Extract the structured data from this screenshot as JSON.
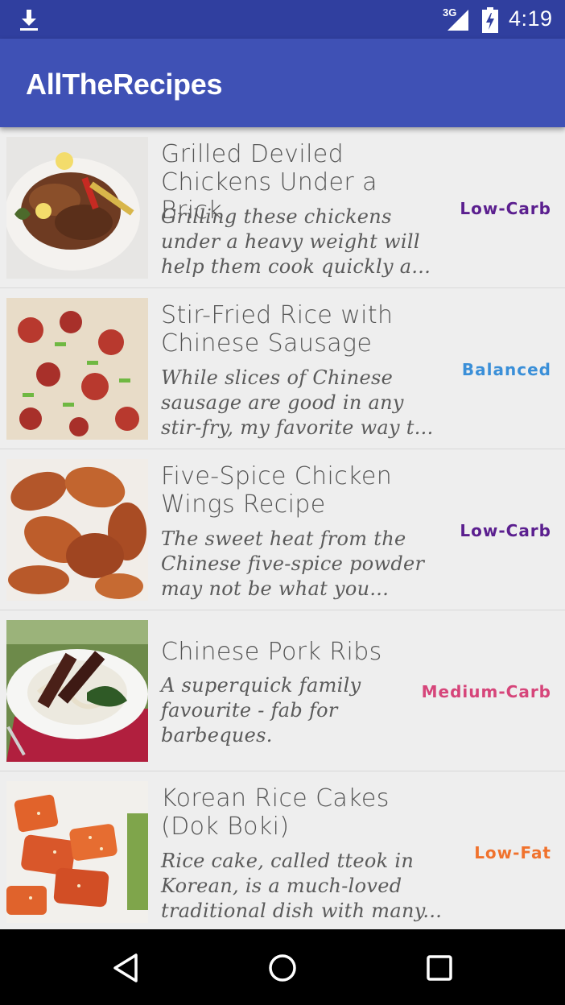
{
  "status_bar": {
    "time": "4:19",
    "network": "3G",
    "icons": [
      "download-icon",
      "signal-icon",
      "battery-icon"
    ]
  },
  "app_bar": {
    "title": "AllTheRecipes"
  },
  "colors": {
    "status_bar": "#303f9f",
    "app_bar": "#3f51b5",
    "low_carb": "#5b1f8f",
    "balanced": "#3a8fd8",
    "medium_carb": "#d6457a",
    "low_fat": "#f0722d"
  },
  "recipes": [
    {
      "title": "Grilled Deviled Chickens Under a Brick",
      "description": "Grilling these chickens under a heavy weight will help them cook quickly a...",
      "tag": "Low-Carb"
    },
    {
      "title": "Stir-Fried Rice with Chinese Sausage",
      "description": "While slices of Chinese sausage are good in any stir-fry, my favorite way t...",
      "tag": "Balanced"
    },
    {
      "title": "Five-Spice Chicken Wings Recipe",
      "description": "The sweet heat from the Chinese five-spice powder may not be what you...",
      "tag": "Low-Carb"
    },
    {
      "title": "Chinese Pork Ribs",
      "description": "A superquick family favourite - fab for barbeques.",
      "tag": "Medium-Carb"
    },
    {
      "title": "Korean Rice Cakes (Dok Boki)",
      "description": "Rice cake, called tteok in Korean, is a much-loved traditional dish with many...",
      "tag": "Low-Fat"
    }
  ],
  "nav_bar": {
    "icons": [
      "back-icon",
      "home-icon",
      "recents-icon"
    ]
  }
}
